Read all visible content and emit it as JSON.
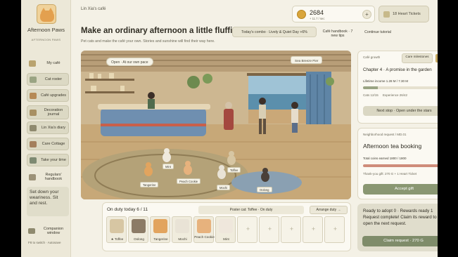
{
  "app": {
    "title": "Afternoon Paws",
    "subtitle": "AFTERNOON PAWS",
    "breadcrumb": "Lin Xia's café"
  },
  "sidebar": {
    "items": [
      {
        "label": "My café",
        "icon": "cafe-icon",
        "color": "#b9a36f"
      },
      {
        "label": "Cat roster",
        "icon": "cat-icon",
        "color": "#9aa483"
      },
      {
        "label": "Café upgrades",
        "icon": "hammer-icon",
        "color": "#b68a56"
      },
      {
        "label": "Decoration journal",
        "icon": "book-icon",
        "color": "#a89063"
      },
      {
        "label": "Lin Xia's diary",
        "icon": "diary-icon",
        "color": "#8f8a6f"
      },
      {
        "label": "Care Cottage",
        "icon": "cottage-icon",
        "color": "#a47f5c"
      },
      {
        "label": "Take your time",
        "icon": "clock-icon",
        "color": "#7e8a72"
      },
      {
        "label": "Regulars' handbook",
        "icon": "handbook-icon",
        "color": "#9c9278"
      }
    ],
    "weary_text": "Set down your weariness. Sit and rest.",
    "companion": "Companion window",
    "hint": "F8 to switch · Autosave"
  },
  "header": {
    "headline": "Make an ordinary afternoon a little fluffier.",
    "tagline": "Pet cats and make the café your own. Stories and sunshine will find their way here.",
    "combo": "Today's combo · Lively & Quiet Day +6%",
    "handbook": "Café handbook · 7 new tips",
    "continue": "Continue tutorial",
    "coins": "2684",
    "coin_rate": "+ 11.7 / sec",
    "tickets": "18 Heart Tickets"
  },
  "scene": {
    "status": "Open · At our own pace",
    "location": "Sea Breeze Pier",
    "cats": [
      "Mint",
      "Tangerine",
      "Peach Cookie",
      "Mochi",
      "Toffee",
      "Oolong"
    ]
  },
  "duty": {
    "title": "On duty today 6 / 11",
    "poster": "Poster cat: Toffee · On duty",
    "arrange": "Arrange duty →",
    "slots": [
      {
        "name": "★ Toffee",
        "color": "#d7c6a3"
      },
      {
        "name": "Oolong",
        "color": "#8c7b66"
      },
      {
        "name": "Tangerine",
        "color": "#e2a45e"
      },
      {
        "name": "Mochi",
        "color": "#e9e3d6"
      },
      {
        "name": "Peach Cookie",
        "color": "#e7b27d"
      },
      {
        "name": "Mint",
        "color": "#efe7dc"
      }
    ],
    "empty_label": "+"
  },
  "growth": {
    "kicker": "Café growth",
    "milestones": "Care milestones",
    "chapter": "Chapter 4 · A promise in the garden",
    "income": "Lifetime income 1.28 M / 7.30 M",
    "income_progress": 0.18,
    "cats": "Cats 12/15",
    "experience": "Experience 26/42",
    "next": "Next stop · Open under the stars"
  },
  "request": {
    "kicker": "Neighborhood request / MD.01",
    "title": "Afternoon tea booking",
    "coins": "Total coins earned  1800 / 1800",
    "coins_progress": 1.0,
    "thanks": "Thank-you gift: 270 G + 1 Heart Ticket",
    "accept": "Accept gift"
  },
  "adopt": {
    "text": "Ready to adopt 0 · Rewards ready 1 Request complete! Claim its reward to open the next request.",
    "claim": "Claim request · 270 G"
  }
}
